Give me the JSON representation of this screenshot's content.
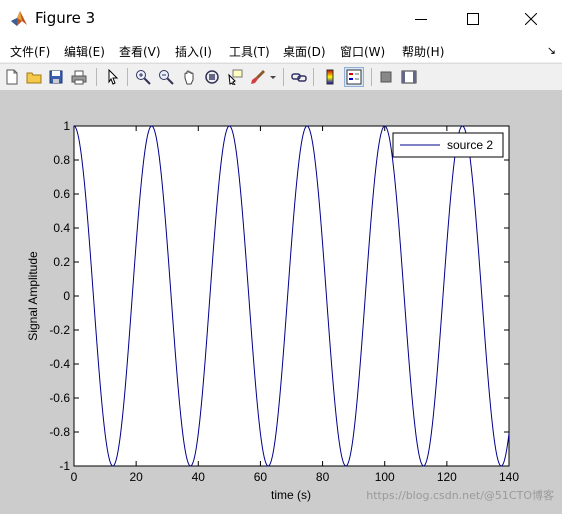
{
  "window": {
    "title": "Figure 3",
    "icon": "matlab-logo-icon"
  },
  "menu": {
    "items": [
      "文件(F)",
      "编辑(E)",
      "查看(V)",
      "插入(I)",
      "工具(T)",
      "桌面(D)",
      "窗口(W)",
      "帮助(H)"
    ],
    "overflow": "↘"
  },
  "toolbar": {
    "buttons": [
      "new-figure-icon",
      "open-file-icon",
      "save-icon",
      "print-icon",
      "pointer-icon",
      "zoom-in-icon",
      "zoom-out-icon",
      "pan-icon",
      "rotate-3d-icon",
      "data-cursor-icon",
      "brush-icon",
      "brush-dropdown-icon",
      "link-icon",
      "colorbar-icon",
      "legend-icon",
      "hide-plot-tools-icon",
      "show-plot-tools-icon"
    ]
  },
  "chart_data": {
    "type": "line",
    "title": "",
    "xlabel": "time (s)",
    "ylabel": "Signal Amplitude",
    "xlim": [
      0,
      140
    ],
    "ylim": [
      -1,
      1
    ],
    "xticks": [
      0,
      20,
      40,
      60,
      80,
      100,
      120,
      140
    ],
    "yticks": [
      -1,
      -0.8,
      -0.6,
      -0.4,
      -0.2,
      0,
      0.2,
      0.4,
      0.6,
      0.8,
      1
    ],
    "legend_position": "top-right",
    "grid": false,
    "series": [
      {
        "name": "source 2",
        "color": "#00008b",
        "function": "cos",
        "period": 25,
        "amplitude": 1,
        "x_range": [
          0,
          140
        ]
      }
    ]
  },
  "watermark": "https://blog.csdn.net/@51CTO博客"
}
